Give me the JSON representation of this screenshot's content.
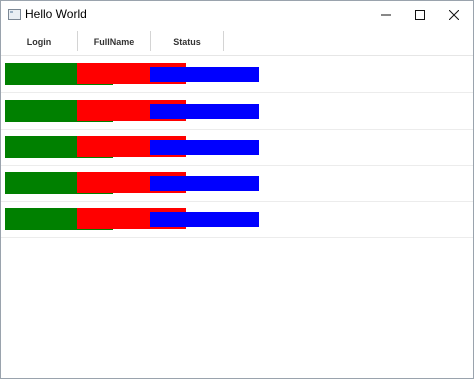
{
  "window": {
    "title": "Hello World",
    "minimize_glyph": "—",
    "maximize_glyph": "☐",
    "close_glyph": "✕"
  },
  "table": {
    "columns": [
      "Login",
      "FullName",
      "Status"
    ],
    "rows": [
      {
        "login": "",
        "fullname": "",
        "status": ""
      },
      {
        "login": "",
        "fullname": "",
        "status": ""
      },
      {
        "login": "",
        "fullname": "",
        "status": ""
      },
      {
        "login": "",
        "fullname": "",
        "status": ""
      },
      {
        "login": "",
        "fullname": "",
        "status": ""
      }
    ]
  },
  "colors": {
    "login_cell": "#008000",
    "fullname_cell": "#ff0000",
    "status_cell": "#0000ff"
  }
}
